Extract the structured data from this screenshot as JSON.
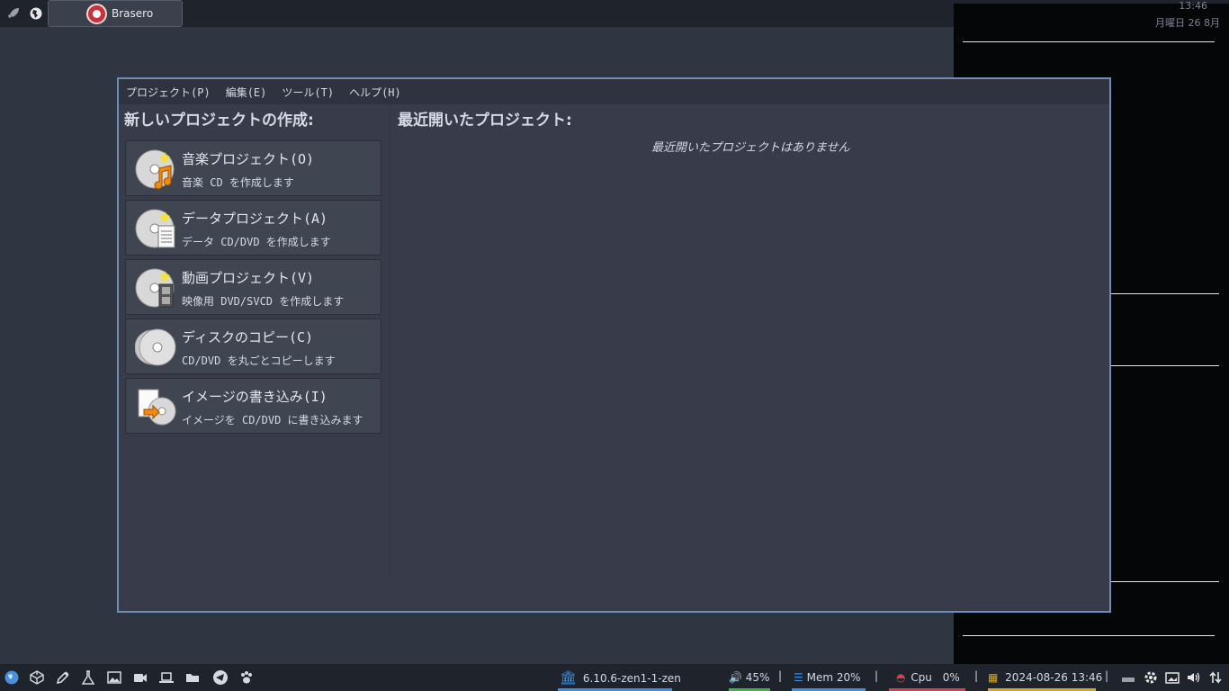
{
  "topbar": {
    "task_title": "Brasero",
    "launcher_icon": "rocket-icon",
    "browser_icon": "globe-icon"
  },
  "conky": {
    "time": "13:46",
    "date": "月曜日 26 8月"
  },
  "window": {
    "menu": [
      "プロジェクト(P)",
      "編集(E)",
      "ツール(T)",
      "ヘルプ(H)"
    ],
    "new_project_title": "新しいプロジェクトの作成:",
    "recent_title": "最近開いたプロジェクト:",
    "recent_empty": "最近開いたプロジェクトはありません",
    "projects": [
      {
        "title": "音楽プロジェクト(O)",
        "subtitle": "音楽 CD を作成します",
        "icon": "audio-disc-icon"
      },
      {
        "title": "データプロジェクト(A)",
        "subtitle": "データ CD/DVD を作成します",
        "icon": "data-disc-icon"
      },
      {
        "title": "動画プロジェクト(V)",
        "subtitle": "映像用 DVD/SVCD を作成します",
        "icon": "video-disc-icon"
      },
      {
        "title": "ディスクのコピー(C)",
        "subtitle": "CD/DVD を丸ごとコピーします",
        "icon": "disc-copy-icon"
      },
      {
        "title": "イメージの書き込み(I)",
        "subtitle": "イメージを CD/DVD に書き込みます",
        "icon": "image-burn-icon"
      }
    ]
  },
  "bottombar": {
    "kernel": "6.10.6-zen1-1-zen",
    "volume": "45%",
    "mem": "Mem 20%",
    "cpu_label": "Cpu",
    "cpu_value": "0%",
    "datetime": "2024-08-26 13:46",
    "separator": "|",
    "colors": {
      "kernel": "#3a8ee6",
      "volume": "#3fb53f",
      "mem": "#3a8ee6",
      "cpu": "#d04050",
      "date": "#d9a520"
    }
  }
}
